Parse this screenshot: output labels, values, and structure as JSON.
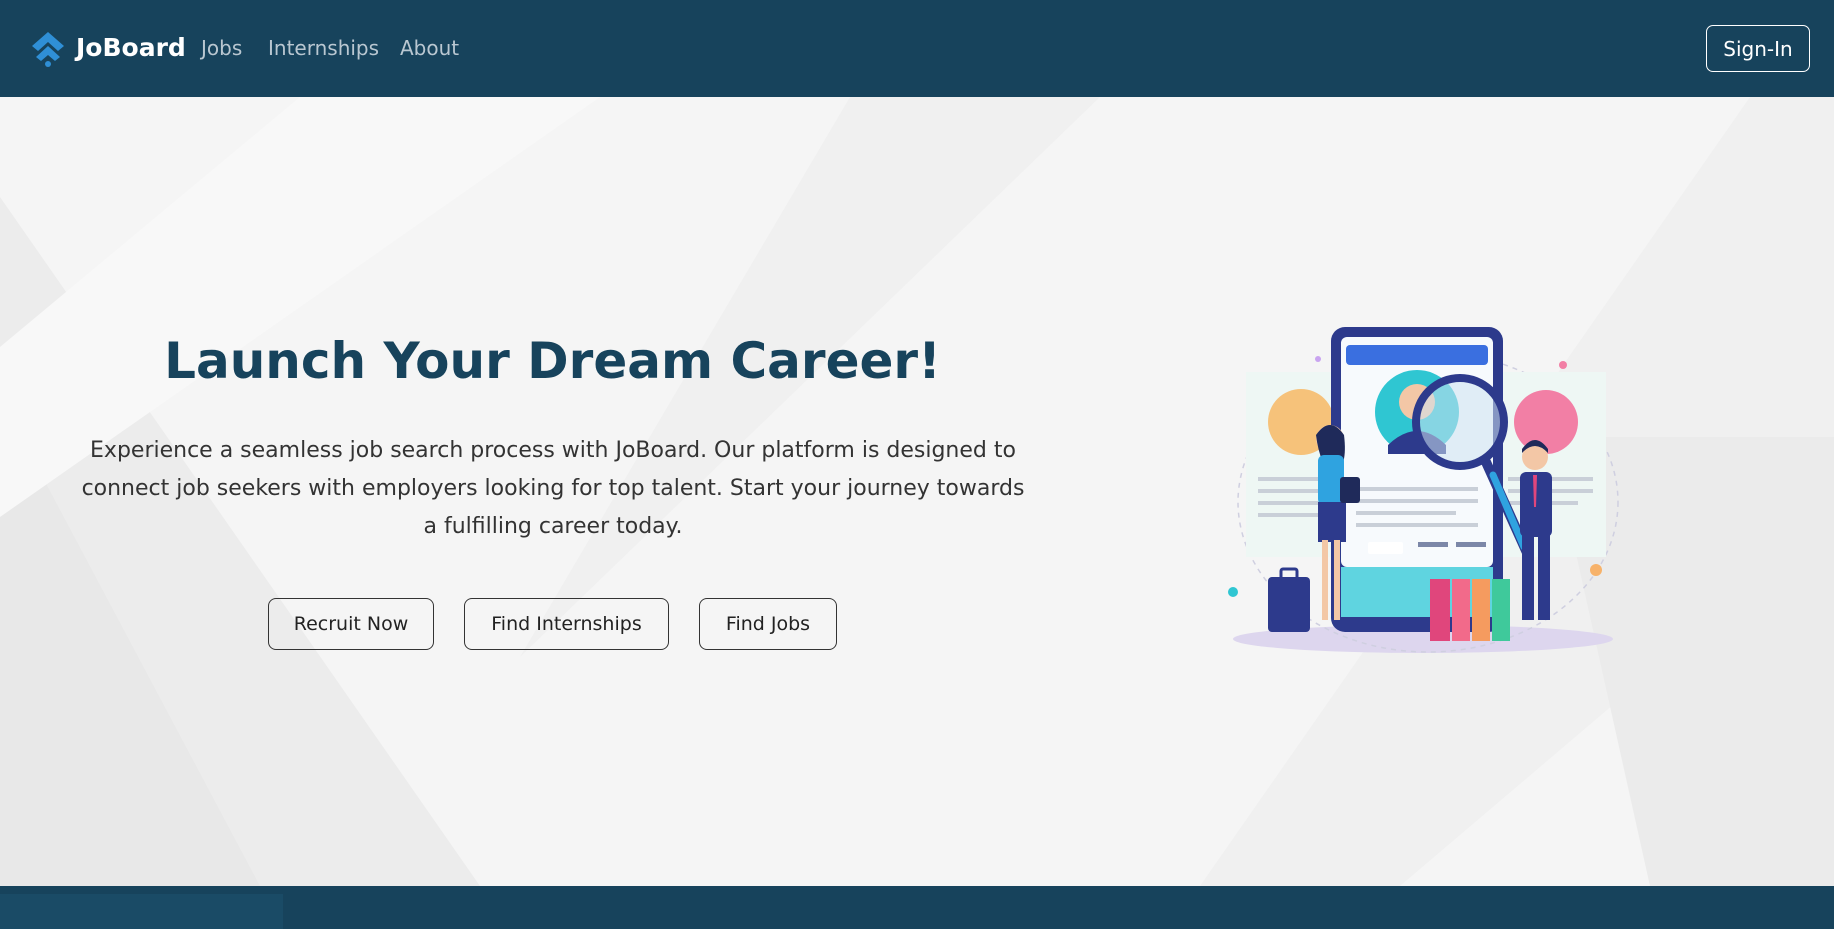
{
  "nav": {
    "brand": "JoBoard",
    "links": [
      "Jobs",
      "Internships",
      "About"
    ],
    "signin_label": "Sign-In"
  },
  "hero": {
    "title": "Launch Your Dream Career!",
    "description": "Experience a seamless job search process with JoBoard. Our platform is designed to connect job seekers with employers looking for top talent. Start your journey towards a fulfilling career today.",
    "buttons": [
      "Recruit Now",
      "Find Internships",
      "Find Jobs"
    ],
    "illustration": "recruitment-magnifier-illustration"
  },
  "colors": {
    "primary": "#17435c",
    "accent": "#2b84c6",
    "hero_bg": "#f5f5f5",
    "text": "#333333"
  }
}
